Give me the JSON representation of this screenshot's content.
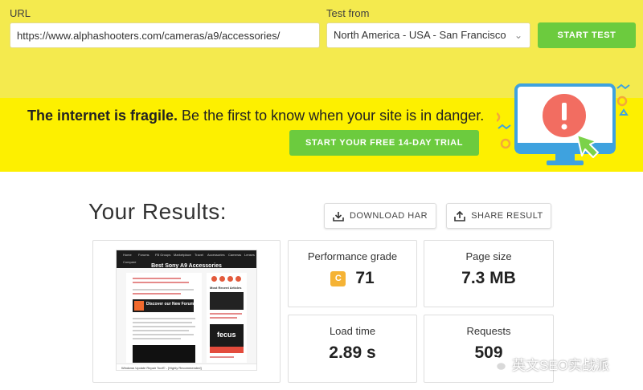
{
  "form": {
    "url_label": "URL",
    "url_value": "https://www.alphashooters.com/cameras/a9/accessories/",
    "test_from_label": "Test from",
    "location_value": "North America - USA - San Francisco",
    "start_label": "START TEST"
  },
  "banner": {
    "bold_text": "The internet is fragile.",
    "rest_text": " Be the first to know when your site is in danger.",
    "trial_label": "START YOUR FREE 14-DAY TRIAL"
  },
  "results": {
    "title": "Your Results:",
    "download_label": "DOWNLOAD HAR",
    "share_label": "SHARE RESULT"
  },
  "metrics": {
    "performance": {
      "label": "Performance grade",
      "grade": "C",
      "value": "71"
    },
    "page_size": {
      "label": "Page size",
      "value": "7.3 MB"
    },
    "load_time": {
      "label": "Load time",
      "value": "2.89 s"
    },
    "requests": {
      "label": "Requests",
      "value": "509"
    }
  },
  "screenshot": {
    "nav_items": [
      "Home",
      "Forums",
      "FB Groups",
      "Marketplace",
      "Travel",
      "Accessories",
      "Cameras",
      "Lenses"
    ],
    "nav_extra": "Compare",
    "title": "Best Sony A9 Accessories",
    "side_heading": "Most Recent Articles",
    "ad_text": "Discover our New Forums!",
    "brand": "fecus",
    "footer_text": "Windows Update Repair Tool© - [Highly Recommended]"
  },
  "watermark": {
    "text": "英文SEO实战派"
  },
  "colors": {
    "top_bar": "#f4ea4e",
    "banner": "#fdf000",
    "accent_green": "#6ccb3e",
    "grade_c": "#f5b335",
    "alert_red": "#f26d61",
    "monitor_blue": "#3ea2df"
  },
  "icons": {
    "select": "chevron-down-icon",
    "download": "download-icon",
    "share": "share-icon",
    "monitor": "monitor-alert-illustration",
    "watermark": "wechat-icon"
  }
}
